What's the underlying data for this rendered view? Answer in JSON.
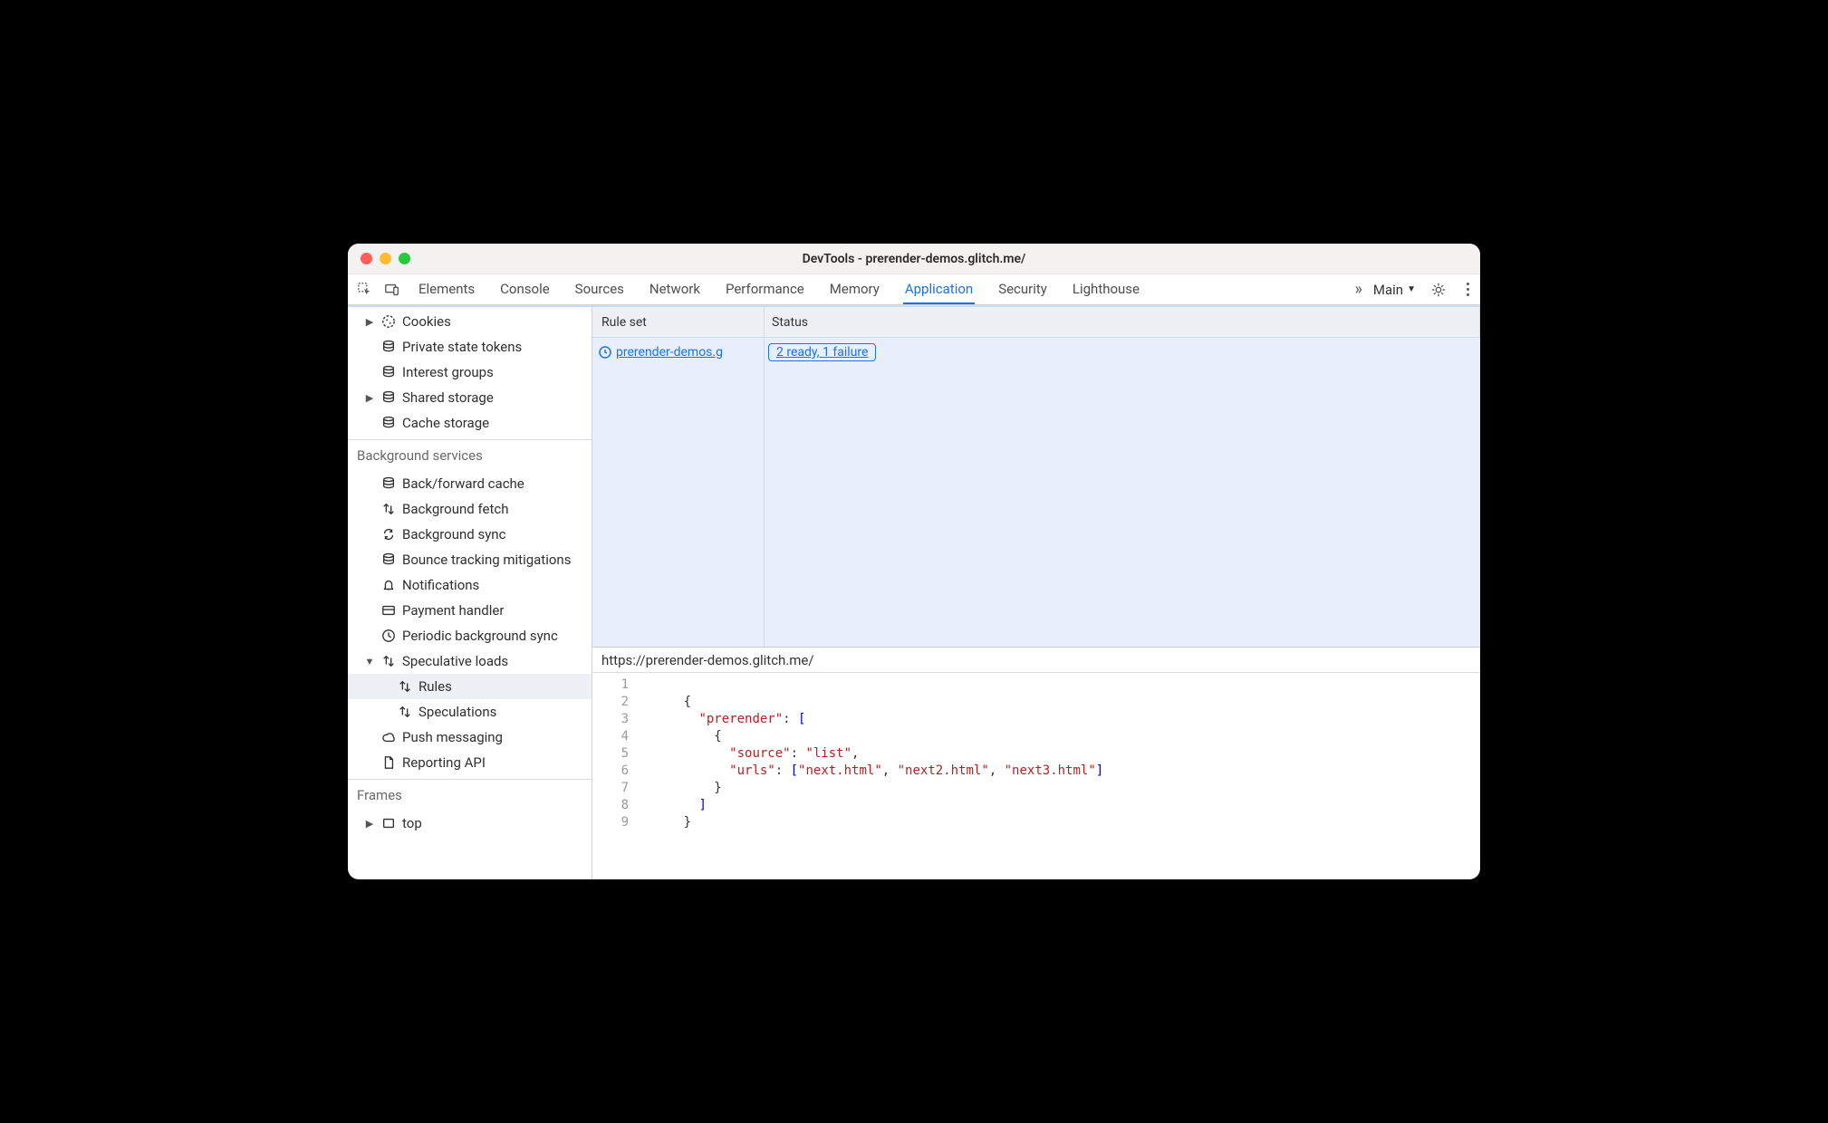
{
  "window": {
    "title": "DevTools - prerender-demos.glitch.me/"
  },
  "toolbar": {
    "tabs": [
      "Elements",
      "Console",
      "Sources",
      "Network",
      "Performance",
      "Memory",
      "Application",
      "Security",
      "Lighthouse"
    ],
    "activeTab": "Application",
    "more": "»",
    "target": "Main"
  },
  "sidebar": {
    "storage": [
      {
        "label": "Cookies",
        "icon": "cookie",
        "arrow": "right"
      },
      {
        "label": "Private state tokens",
        "icon": "db",
        "arrow": "none"
      },
      {
        "label": "Interest groups",
        "icon": "db",
        "arrow": "none"
      },
      {
        "label": "Shared storage",
        "icon": "db",
        "arrow": "right"
      },
      {
        "label": "Cache storage",
        "icon": "db",
        "arrow": "none"
      }
    ],
    "bgHead": "Background services",
    "bg": [
      {
        "label": "Back/forward cache",
        "icon": "db",
        "arrow": "none"
      },
      {
        "label": "Background fetch",
        "icon": "arrows",
        "arrow": "none"
      },
      {
        "label": "Background sync",
        "icon": "sync",
        "arrow": "none"
      },
      {
        "label": "Bounce tracking mitigations",
        "icon": "db",
        "arrow": "none"
      },
      {
        "label": "Notifications",
        "icon": "bell",
        "arrow": "none"
      },
      {
        "label": "Payment handler",
        "icon": "card",
        "arrow": "none"
      },
      {
        "label": "Periodic background sync",
        "icon": "clock",
        "arrow": "none"
      },
      {
        "label": "Speculative loads",
        "icon": "arrows",
        "arrow": "down"
      },
      {
        "label": "Rules",
        "icon": "arrows",
        "arrow": "none",
        "depth": 2,
        "selected": true
      },
      {
        "label": "Speculations",
        "icon": "arrows",
        "arrow": "none",
        "depth": 2
      },
      {
        "label": "Push messaging",
        "icon": "cloud",
        "arrow": "none"
      },
      {
        "label": "Reporting API",
        "icon": "doc",
        "arrow": "none"
      }
    ],
    "framesHead": "Frames",
    "frames": [
      {
        "label": "top",
        "icon": "frame",
        "arrow": "right"
      }
    ]
  },
  "grid": {
    "headers": {
      "rule": "Rule set",
      "status": "Status"
    },
    "row": {
      "rule": "prerender-demos.g",
      "status": "2 ready, 1 failure"
    }
  },
  "source": {
    "url": "https://prerender-demos.glitch.me/",
    "lines": [
      1,
      2,
      3,
      4,
      5,
      6,
      7,
      8,
      9
    ],
    "code": {
      "k_prerender": "\"prerender\"",
      "k_source": "\"source\"",
      "v_list": "\"list\"",
      "k_urls": "\"urls\"",
      "u1": "\"next.html\"",
      "u2": "\"next2.html\"",
      "u3": "\"next3.html\""
    }
  }
}
